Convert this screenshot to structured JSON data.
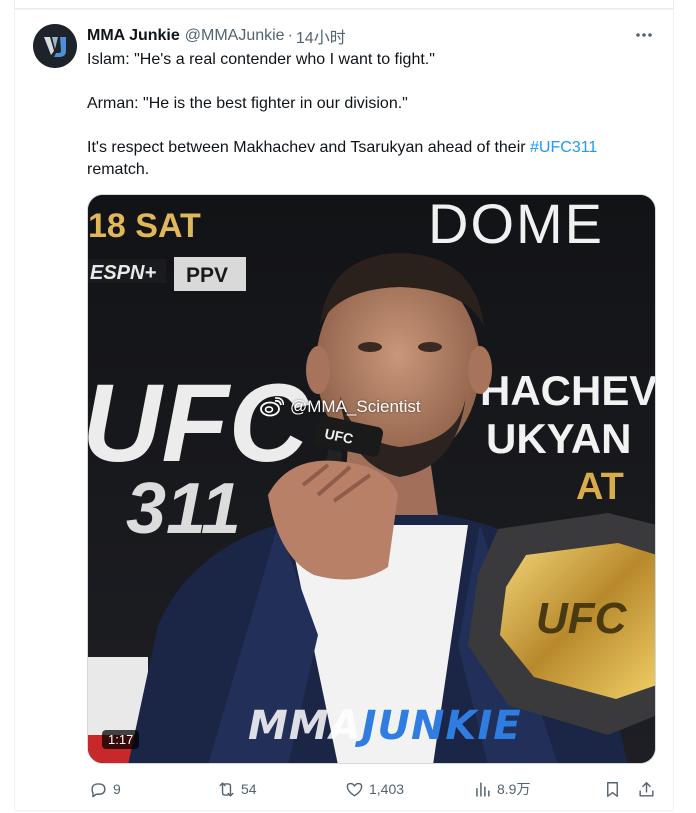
{
  "author": {
    "name": "MMA Junkie",
    "handle": "@MMAJunkie",
    "separator": "·",
    "time": "14小时"
  },
  "tweet": {
    "line1": "Islam: \"He's a real contender who I want to fight.\"",
    "line2": "Arman: \"He is the best fighter in our division.\"",
    "line3_before": "It's respect between Makhachev and Tsarukyan ahead of their ",
    "hashtag": "#UFC311",
    "line3_after": "rematch."
  },
  "media": {
    "duration": "1:17",
    "weibo_watermark": "@MMA_Scientist",
    "logo_left": "MMA",
    "logo_right": "JUNKIE",
    "backdrop": {
      "date": "18 SAT",
      "sponsor": "DOME",
      "espn": "ESPN+",
      "ppv": "PPV",
      "event": "UFC",
      "event_number": "311",
      "name1": "HACHEV",
      "name2": "UKYAN",
      "sat": "AT",
      "mic_brand": "UFC",
      "belt": "UFC"
    }
  },
  "actions": {
    "replies": "9",
    "retweets": "54",
    "likes": "1,403",
    "views": "8.9万"
  },
  "colors": {
    "accent": "#1d9bf0",
    "muted": "#536471"
  },
  "icons": [
    "avatar-logo",
    "more-icon",
    "reply-icon",
    "retweet-icon",
    "like-icon",
    "views-icon",
    "bookmark-icon",
    "share-icon",
    "weibo-icon"
  ]
}
